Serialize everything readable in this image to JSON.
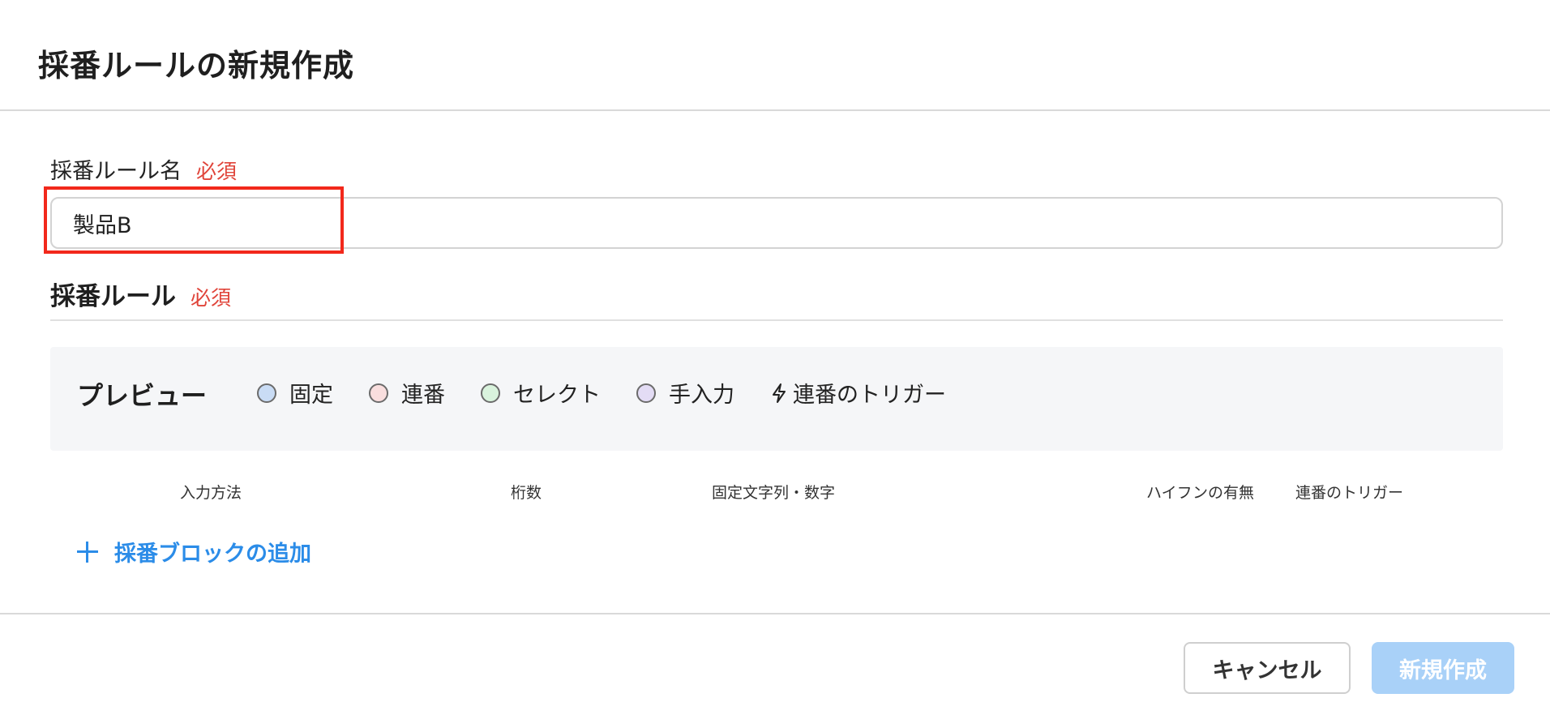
{
  "dialog": {
    "title": "採番ルールの新規作成"
  },
  "name_field": {
    "label": "採番ルール名",
    "required": "必須",
    "value": "製品B"
  },
  "rule_section": {
    "title": "採番ルール",
    "required": "必須"
  },
  "preview": {
    "title": "プレビュー",
    "legend": [
      {
        "label": "固定",
        "color": "#c9dcf5"
      },
      {
        "label": "連番",
        "color": "#f9dede"
      },
      {
        "label": "セレクト",
        "color": "#d9f3dd"
      },
      {
        "label": "手入力",
        "color": "#e3dcf5"
      }
    ],
    "trigger_label": "連番のトリガー",
    "trigger_icon": "lightning-bolt-icon"
  },
  "table": {
    "columns": [
      "入力方法",
      "桁数",
      "固定文字列・数字",
      "ハイフンの有無",
      "連番のトリガー"
    ]
  },
  "add_block": {
    "label": "採番ブロックの追加",
    "icon": "plus-icon",
    "color": "#2b8ce8"
  },
  "footer": {
    "cancel_label": "キャンセル",
    "create_label": "新規作成",
    "create_color": "#a9d1f8"
  }
}
